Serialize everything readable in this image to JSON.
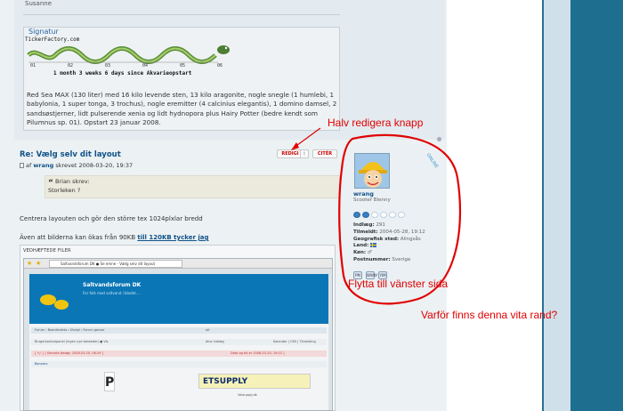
{
  "top_post": {
    "username_cut": "Susanne",
    "signature_label": "Signatur",
    "ticker_site": "TickerFactory.com",
    "ticker_ticks": [
      "01",
      "02",
      "03",
      "04",
      "05",
      "06"
    ],
    "ticker_text": "1 month 3 weeks 6 days since Akvarieopstart",
    "signature_body": "Red Sea MAX (130 liter) med 16 kilo levende sten, 13 kilo aragonite, nogle snegle (1 humlebi, 1 babylonia, 1 super tonga, 3 trochus), nogle eremitter (4 calcinius elegantis), 1 domino damsel, 2 sandsøstjerner, lidt pulserende xenia og lidt hydnopora plus Hairy Potter (bedre kendt som Pilumnus sp. 01). Opstart 23 januar 2008."
  },
  "post": {
    "title": "Re: Vælg selv dit layout",
    "meta_prefix": "af",
    "author": "wrang",
    "meta_suffix": "skrevet 2008-03-20, 19:37",
    "edit_button": "REDIGI",
    "close_button": "!",
    "quote_button": "CITÉR",
    "quote_author": "Brian skrev:",
    "quote_text": "Storleken ?",
    "body_line1": "Centrera layouten och gör den större tex 1024plxlar bredd",
    "body_line2_prefix": "Även att bilderna kan ökas från 90KB",
    "body_line2_link": "till 120KB tycker jag",
    "attachments_label": "VEDHÆFTEDE FILER"
  },
  "screenshot": {
    "tab_title": "Saltvandsforum DK ● Se emne - Vælg selv dit layout",
    "site_title": "Saltvandsforum DK",
    "site_subtitle": "For folk med saltvand i blodet....",
    "row1_left": "Forum › Boardindeks › Øvrigt › Forum genser",
    "row1_right": "alt",
    "row2_left": "Brugerkontrolpanel (ingen nye beskeder) ● Vis",
    "row2_mid": "dine indlæg",
    "row2_right": "Kalender | OSS | Tilmelding",
    "row3_left": "[ +/- ] | Seneste besøg: 2008-03-20, 06:29 ]",
    "row3_right": "Dato og tid er 2008-03-20, 19:22 ]",
    "banners_label": "Banners",
    "banner_text": "ETSUPPLY",
    "footer_text": "Velaupply.dk"
  },
  "profile": {
    "online": "ONLINE",
    "name": "wrang",
    "rank": "Scooter Blenny",
    "stats": [
      {
        "label": "Indlæg:",
        "value": "291"
      },
      {
        "label": "Tilmeldt:",
        "value": "2004-05-28, 19:12"
      },
      {
        "label": "Geografisk sted:",
        "value": "Alingsås"
      },
      {
        "label": "Land:",
        "value": ""
      },
      {
        "label": "Køn:",
        "value": ""
      },
      {
        "label": "Postnummer:",
        "value": "Sverige"
      }
    ],
    "icons": [
      "PM",
      "WWW",
      "YIM"
    ]
  },
  "annotations": {
    "edit_note": "Halv redigera knapp",
    "profile_note": "Flytta till vänster sida",
    "strip_note": "Varför finns denna vita rand?"
  },
  "colors": {
    "annotation": "#e10000",
    "link": "#105289",
    "right_bar": "#1e6f8f"
  }
}
